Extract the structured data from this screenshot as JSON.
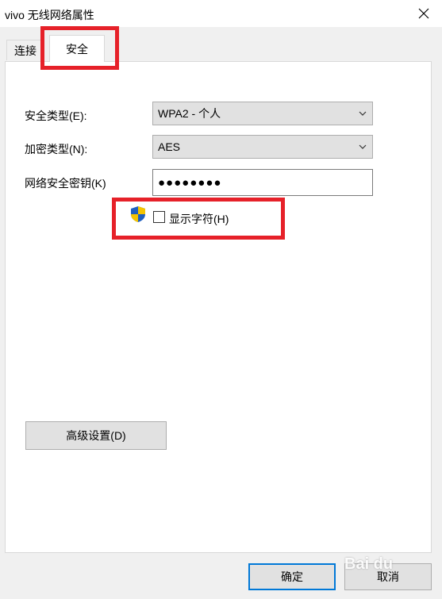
{
  "window": {
    "title": "vivo 无线网络属性"
  },
  "tabs": [
    {
      "label": "连接",
      "active": false
    },
    {
      "label": "安全",
      "active": true
    }
  ],
  "form": {
    "security_type": {
      "label": "安全类型(E):",
      "value": "WPA2 - 个人"
    },
    "encryption_type": {
      "label": "加密类型(N):",
      "value": "AES"
    },
    "network_key": {
      "label": "网络安全密钥(K)",
      "value": "●●●●●●●●"
    },
    "show_chars": {
      "label": "显示字符(H)",
      "checked": false
    }
  },
  "buttons": {
    "advanced": "高级设置(D)",
    "ok": "确定",
    "cancel": "取消"
  },
  "watermark": "Bai du",
  "colors": {
    "highlight_box": "#e62129",
    "default_button_border": "#0078d7"
  },
  "icons": [
    "close-icon",
    "chevron-down-icon",
    "uac-shield-icon"
  ]
}
